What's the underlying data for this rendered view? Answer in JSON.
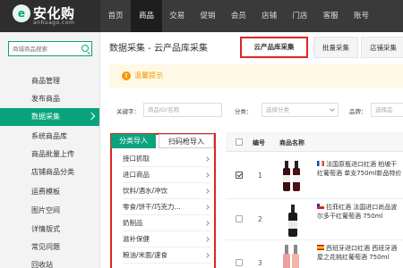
{
  "brand": {
    "logo_mark": "e",
    "name": "安化购",
    "sub": "anhuago.com"
  },
  "nav": [
    "首页",
    "商品",
    "交易",
    "促销",
    "会员",
    "店铺",
    "门店",
    "客服",
    "账号"
  ],
  "sidebar": {
    "search_placeholder": "商城商品搜索",
    "items": [
      {
        "label": "商品管理"
      },
      {
        "label": "发布商品"
      },
      {
        "label": "数据采集"
      },
      {
        "label": "系统商品库"
      },
      {
        "label": "商品批量上传"
      },
      {
        "label": "店铺商品分类"
      },
      {
        "label": "运费模板"
      },
      {
        "label": "图片空间"
      },
      {
        "label": "详情版式"
      },
      {
        "label": "常见问题"
      },
      {
        "label": "回收站"
      }
    ]
  },
  "main": {
    "title": "数据采集 - 云产品库采集",
    "tabs": [
      "云产品库采集",
      "批量采集",
      "店铺采集"
    ],
    "tip": "温馨提示",
    "filters": {
      "keyword_label": "关键字：",
      "keyword_placeholder": "商品ID/名称",
      "category_label": "分类：",
      "category_placeholder": "选择分类",
      "brand_label": "品牌：",
      "brand_placeholder": "选择品"
    },
    "import_tabs": [
      "分类导入",
      "扫码枪导入"
    ],
    "categories": [
      "接口抓取",
      "进口商品",
      "饮料/酒水/冲饮",
      "零食/饼干/巧克力...",
      "奶制品",
      "滋补保健",
      "粮油/米面/速食"
    ],
    "table": {
      "headers": [
        "编号",
        "商品名称"
      ],
      "rows": [
        {
          "index": "1",
          "checked": true,
          "flag": "fr",
          "name": "法国原瓶进口红酒 柏坡干红葡萄酒 单支750ml新品特价"
        },
        {
          "index": "2",
          "checked": false,
          "flag": "cl",
          "name": "拉菲红酒 法国进口尚品波尔多干红葡萄酒 750ml"
        },
        {
          "index": "3",
          "checked": false,
          "flag": "es",
          "name": "西班牙进口红酒 西班牙酒屋之花桃红葡萄酒 750ml"
        }
      ]
    }
  }
}
